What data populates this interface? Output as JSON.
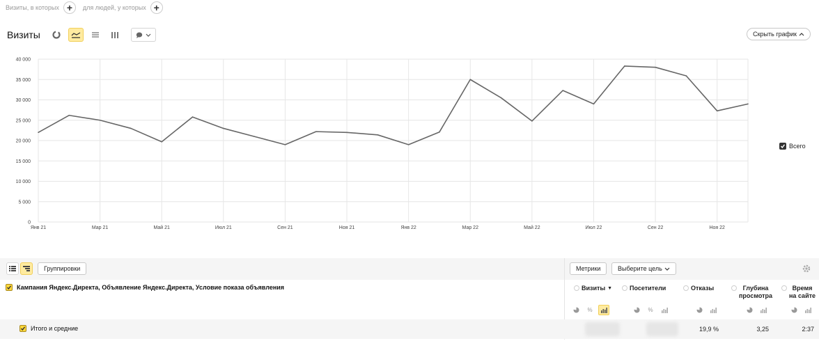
{
  "filter": {
    "visits_where": "Визиты, в которых",
    "people_who": "для людей, у которых",
    "plus": "+"
  },
  "chart_header": {
    "title": "Визиты",
    "hide_chart_label": "Скрыть график"
  },
  "chart_data": {
    "type": "line",
    "x": [
      "2021-01",
      "2021-02",
      "2021-03",
      "2021-04",
      "2021-05",
      "2021-06",
      "2021-07",
      "2021-08",
      "2021-09",
      "2021-10",
      "2021-11",
      "2021-12",
      "2022-01",
      "2022-02",
      "2022-03",
      "2022-04",
      "2022-05",
      "2022-06",
      "2022-07",
      "2022-08",
      "2022-09",
      "2022-10",
      "2022-11",
      "2022-12"
    ],
    "x_tick_labels": [
      "Янв 21",
      "Мар 21",
      "Май 21",
      "Июл 21",
      "Сен 21",
      "Ноя 21",
      "Янв 22",
      "Мар 22",
      "Май 22",
      "Июл 22",
      "Сен 22",
      "Ноя 22"
    ],
    "y_tick_labels": [
      "0",
      "5 000",
      "10 000",
      "15 000",
      "20 000",
      "25 000",
      "30 000",
      "35 000",
      "40 000"
    ],
    "ylim": [
      0,
      40000
    ],
    "grid": true,
    "line_color": "#666666",
    "series": [
      {
        "name": "Всего",
        "values": [
          22000,
          26200,
          25000,
          23000,
          19700,
          25800,
          23000,
          21000,
          19000,
          22200,
          22000,
          21400,
          19000,
          22100,
          35000,
          30500,
          24800,
          32300,
          29000,
          38300,
          38000,
          35900,
          27300,
          29000
        ]
      }
    ],
    "legend_position": "right"
  },
  "legend": {
    "label": "Всего"
  },
  "table": {
    "groupings_label": "Группировки",
    "metrics_label": "Метрики",
    "goal_label": "Выберите цель",
    "dimension_label": "Кампания Яндекс.Директа, Объявление Яндекс.Директа, Условие показа объявления",
    "totals_label": "Итого и средние",
    "columns": [
      {
        "label": "Визиты",
        "sort": "▼",
        "total": ""
      },
      {
        "label": "Посетители",
        "total": ""
      },
      {
        "label": "Отказы",
        "total": "19,9 %"
      },
      {
        "label1": "Глубина",
        "label2": "просмотра",
        "total": "3,25"
      },
      {
        "label1": "Время",
        "label2": "на сайте",
        "total": "2:37"
      }
    ]
  },
  "colors": {
    "accent": "#ffeba0",
    "accent_border": "#f1cf5a",
    "row_bg": "#f5f5f5"
  }
}
